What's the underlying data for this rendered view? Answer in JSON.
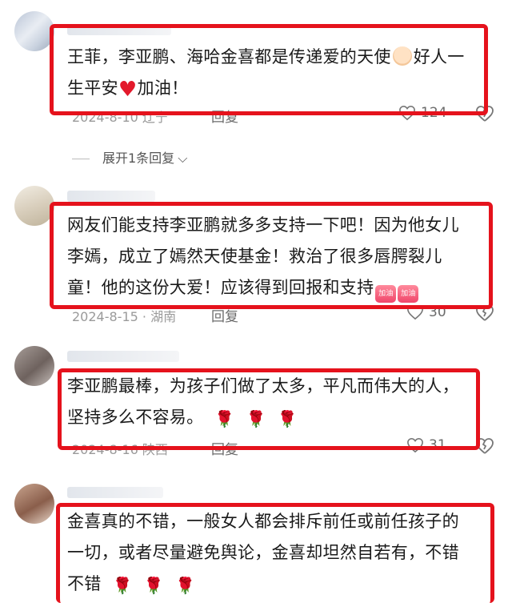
{
  "comments": [
    {
      "text_line1": "王菲，李亚鹏、海哈金喜都是传递爱的天使",
      "text_line1_tail": "好人一",
      "text_line2": "生平安",
      "text_line2_tail": "加油！",
      "date": "2024-8-10 辽宁",
      "reply_label": "回复",
      "likes": "124",
      "expand_label": "展开1条回复"
    },
    {
      "text_line1": "网友们能支持李亚鹏就多多支持一下吧！因为他女儿",
      "text_line2": "李嫣，成立了嫣然天使基金！救治了很多唇腭裂儿",
      "text_line3": "童！他的这份大爱！应该得到回报和支持",
      "emoji_label": "加油",
      "date": "2024-8-15 · 湖南",
      "reply_label": "回复",
      "likes": "30"
    },
    {
      "text_line1": "李亚鹏最棒，为孩子们做了太多，平凡而伟大的人，",
      "text_line2": "坚持多么不容易。",
      "date": "2024-8-16 陕西",
      "reply_label": "回复",
      "likes": "31"
    },
    {
      "text_line1": "金喜真的不错，一般女人都会排斥前任或前任孩子的",
      "text_line2": "一切，或者尽量避免舆论，金喜却坦然自若有，不错",
      "text_line3": "不错"
    }
  ],
  "colors": {
    "highlight_box": "#e5121c",
    "heart": "#e3192b"
  }
}
